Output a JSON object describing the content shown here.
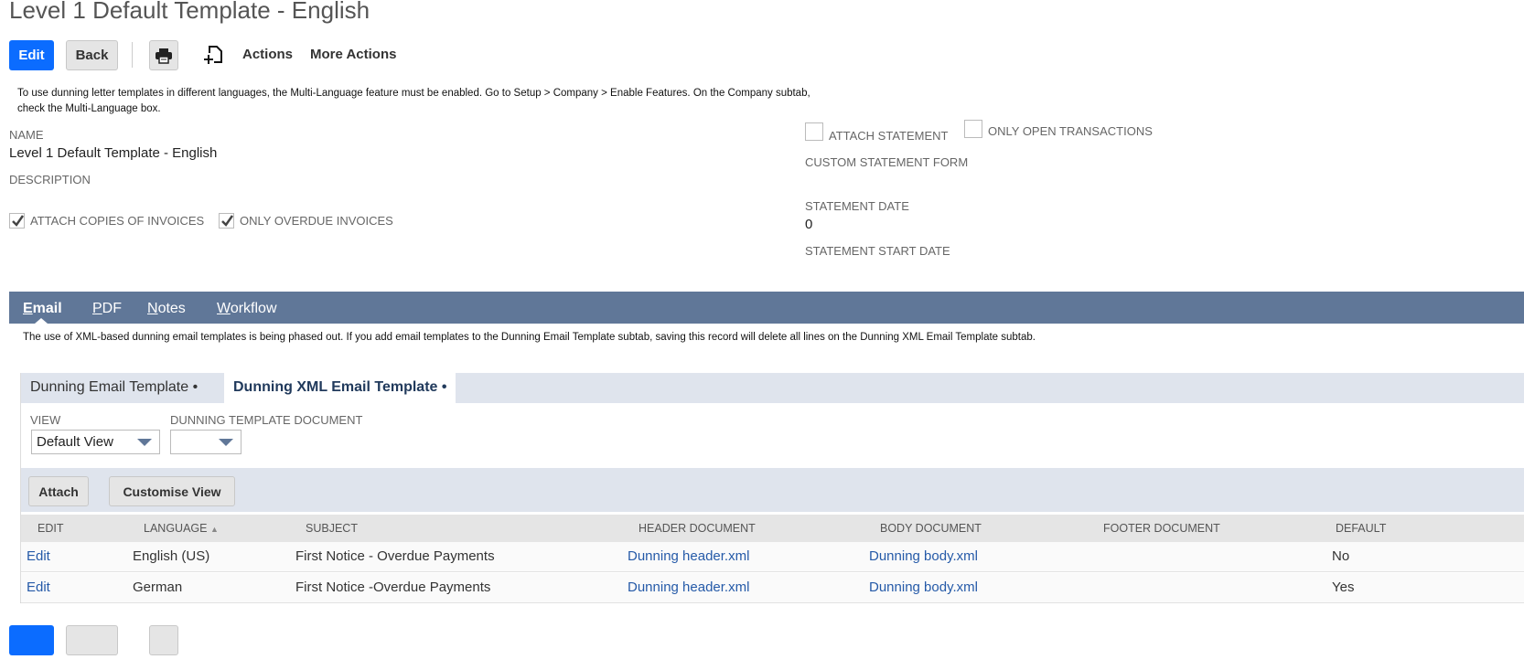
{
  "page": {
    "title": "Level 1 Default Template - English"
  },
  "toolbar": {
    "edit": "Edit",
    "back": "Back",
    "actions": "Actions",
    "more_actions": "More Actions",
    "icons": [
      "printer-icon",
      "new-document-icon"
    ]
  },
  "notice": "To use dunning letter templates in different languages, the Multi-Language feature must be enabled. Go to Setup > Company > Enable Features. On the Company subtab, check the Multi-Language box.",
  "fields": {
    "name_label": "NAME",
    "name_value": "Level 1 Default Template - English",
    "description_label": "DESCRIPTION",
    "attach_copies": {
      "label": "ATTACH COPIES OF INVOICES",
      "checked": true
    },
    "only_overdue": {
      "label": "ONLY OVERDUE INVOICES",
      "checked": true
    },
    "attach_statement": {
      "label": "ATTACH STATEMENT",
      "checked": false
    },
    "only_open": {
      "label": "ONLY OPEN TRANSACTIONS",
      "checked": false
    },
    "custom_statement_form_label": "CUSTOM STATEMENT FORM",
    "statement_date_label": "STATEMENT DATE",
    "statement_date_value": "0",
    "statement_start_date_label": "STATEMENT START DATE"
  },
  "tabs": [
    {
      "first": "E",
      "rest": "mail"
    },
    {
      "first": "P",
      "rest": "DF"
    },
    {
      "first": "N",
      "rest": "otes"
    },
    {
      "first": "W",
      "rest": "orkflow"
    }
  ],
  "warning": "The use of XML-based dunning email templates is being phased out. If you add email templates to the Dunning Email Template subtab, saving this record will delete all lines on the Dunning XML Email Template subtab.",
  "subtabs": {
    "t1": "Dunning Email Template •",
    "t2": "Dunning XML Email Template •"
  },
  "filters": {
    "view_label": "VIEW",
    "view_value": "Default View",
    "doc_label": "DUNNING TEMPLATE DOCUMENT",
    "doc_value": ""
  },
  "list_buttons": {
    "attach": "Attach",
    "customise": "Customise View"
  },
  "table": {
    "headers": [
      "EDIT",
      "LANGUAGE",
      "SUBJECT",
      "HEADER DOCUMENT",
      "BODY DOCUMENT",
      "FOOTER DOCUMENT",
      "DEFAULT"
    ],
    "rows": [
      [
        "Edit",
        "English (US)",
        "First Notice - Overdue Payments",
        "Dunning header.xml",
        "Dunning body.xml",
        "",
        "No"
      ],
      [
        "Edit",
        "German",
        "First Notice -Overdue Payments",
        "Dunning header.xml",
        "Dunning body.xml",
        "",
        "Yes"
      ]
    ]
  },
  "colors": {
    "primary": "#0b6cff",
    "tabbar": "#607798",
    "link": "#255aa8"
  }
}
